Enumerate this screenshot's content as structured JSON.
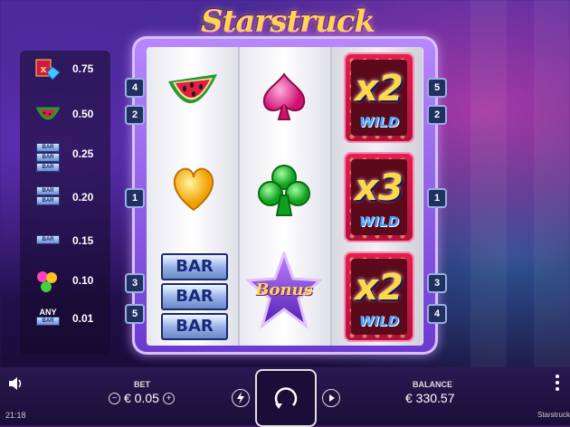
{
  "game": {
    "title": "Starstruck"
  },
  "paytable": [
    {
      "symbol": "wild-and-diamond",
      "value": "0.75"
    },
    {
      "symbol": "watermelon",
      "value": "0.50"
    },
    {
      "symbol": "triple-bar",
      "value": "0.25"
    },
    {
      "symbol": "double-bar",
      "value": "0.20"
    },
    {
      "symbol": "single-bar",
      "value": "0.15"
    },
    {
      "symbol": "gems",
      "value": "0.10"
    },
    {
      "symbol": "any-bar",
      "label": "ANY",
      "bar_text": "BAR",
      "value": "0.01"
    }
  ],
  "paylines_left": [
    "4",
    "2",
    "1",
    "3",
    "5"
  ],
  "paylines_right": [
    "5",
    "2",
    "1",
    "3",
    "4"
  ],
  "reels": {
    "reel1": [
      "watermelon",
      "heart",
      "triple-bar"
    ],
    "reel2": [
      "spade",
      "club",
      "bonus-star"
    ],
    "reel3": [
      "wild-x2",
      "wild-x3",
      "wild-x2"
    ]
  },
  "symbols": {
    "bar_text": "BAR",
    "bonus_text": "Bonus",
    "wild_word": "WILD",
    "wild_top_mult": "x2",
    "wild_mid_mult": "x3",
    "wild_bottom_mult": "x2"
  },
  "controls": {
    "bet_label": "BET",
    "bet_value": "€ 0.05",
    "bet_minus": "−",
    "bet_plus": "+",
    "balance_label": "BALANCE",
    "balance_value": "€ 330.57",
    "time": "21:18",
    "game_name": "Starstruck"
  },
  "icons": {
    "sound": "speaker-icon",
    "turbo": "lightning-icon",
    "spin": "spin-arrow-icon",
    "autoplay": "play-icon",
    "menu": "kebab-menu-icon"
  },
  "colors": {
    "frame": "#8a5ae0",
    "wild_bg": "#d01848",
    "title": "#ffd84a",
    "bottom_bar": "#1a0e38"
  }
}
